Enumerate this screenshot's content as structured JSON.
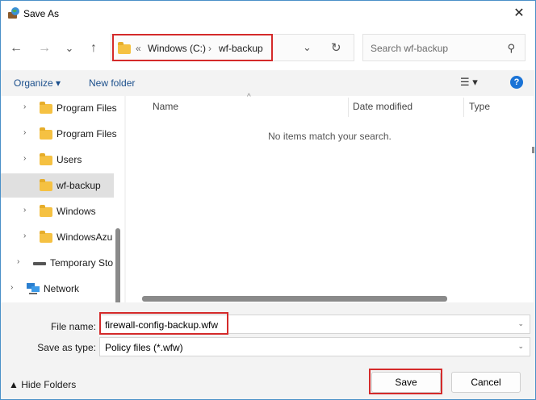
{
  "window": {
    "title": "Save As",
    "close_glyph": "✕"
  },
  "nav": {
    "back_glyph": "←",
    "forward_glyph": "→",
    "recent_glyph": "⌄",
    "up_glyph": "↑",
    "breadcrumb": {
      "chevron_glyph": "«",
      "items": [
        "Windows (C:)",
        "wf-backup"
      ],
      "separator": "›"
    },
    "dropdown_glyph": "⌄",
    "refresh_glyph": "↻"
  },
  "search": {
    "placeholder": "Search wf-backup",
    "icon_glyph": "⚲"
  },
  "toolbar": {
    "organize_label": "Organize ▾",
    "new_folder_label": "New folder",
    "view_glyph": "☰ ▾",
    "help_glyph": "?"
  },
  "tree": {
    "items": [
      {
        "label": "Program Files",
        "chevron": "›",
        "selected": false
      },
      {
        "label": "Program Files",
        "chevron": "›",
        "selected": false
      },
      {
        "label": "Users",
        "chevron": "›",
        "selected": false
      },
      {
        "label": "wf-backup",
        "chevron": "",
        "selected": true
      },
      {
        "label": "Windows",
        "chevron": "›",
        "selected": false
      },
      {
        "label": "WindowsAzu",
        "chevron": "›",
        "selected": false
      },
      {
        "label": "Temporary Sto",
        "chevron": "›",
        "selected": false
      },
      {
        "label": "Network",
        "chevron": "›",
        "selected": false
      }
    ]
  },
  "file_list": {
    "columns": [
      "Name",
      "Date modified",
      "Type"
    ],
    "sort_glyph": "^",
    "empty_message": "No items match your search."
  },
  "fields": {
    "file_name_label": "File name:",
    "file_name_value": "firewall-config-backup.wfw",
    "type_label": "Save as type:",
    "type_value": "Policy files (*.wfw)",
    "dropdown_glyph": "⌄"
  },
  "footer": {
    "hide_folders_label": "▲ Hide Folders",
    "save_label": "Save",
    "cancel_label": "Cancel"
  },
  "colors": {
    "highlight": "#d42a2a",
    "accent": "#1a73d6",
    "folder": "#f5c142"
  }
}
